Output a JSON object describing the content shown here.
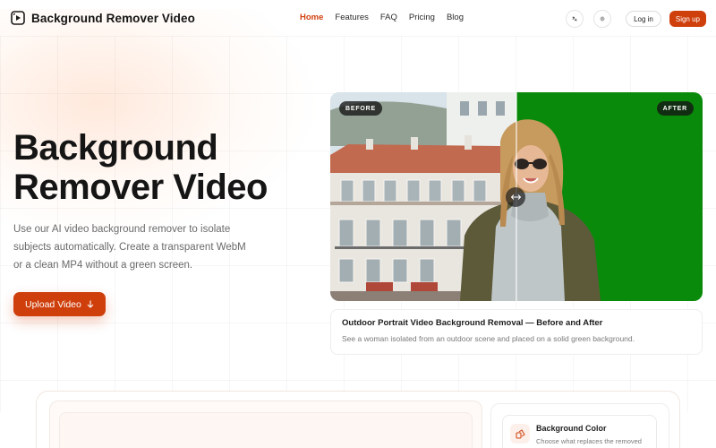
{
  "header": {
    "brand_name": "Background Remover Video",
    "nav": [
      {
        "label": "Home",
        "active": true
      },
      {
        "label": "Features",
        "active": false
      },
      {
        "label": "FAQ",
        "active": false
      },
      {
        "label": "Pricing",
        "active": false
      },
      {
        "label": "Blog",
        "active": false
      }
    ],
    "language_icon": "translate-icon",
    "theme_icon": "sun-icon",
    "login_label": "Log in",
    "signup_label": "Sign up"
  },
  "hero": {
    "title_line1": "Background",
    "title_line2": "Remover Video",
    "description": "Use our AI video background remover to isolate subjects automatically. Create a transparent WebM or a clean MP4 without a green screen.",
    "upload_label": "Upload Video",
    "upload_icon": "arrow-down-icon"
  },
  "comparison": {
    "before_label": "BEFORE",
    "after_label": "AFTER",
    "handle_icon": "arrows-horizontal-icon",
    "after_background_color": "#0a8a0a",
    "caption_title": "Outdoor Portrait Video Background Removal — Before and After",
    "caption_text": "See a woman isolated from an outdoor scene and placed on a solid green background."
  },
  "settings": {
    "color_title": "Background Color",
    "color_subtitle": "Choose what replaces the removed",
    "color_icon": "palette-icon"
  },
  "colors": {
    "accent": "#cf3f0c",
    "text": "#151515",
    "muted": "#6a6a6a"
  }
}
